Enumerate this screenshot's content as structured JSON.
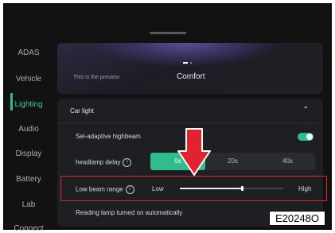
{
  "sidebar": {
    "items": [
      {
        "label": "ADAS"
      },
      {
        "label": "Vehicle"
      },
      {
        "label": "Lighting",
        "active": true
      },
      {
        "label": "Audio"
      },
      {
        "label": "Display"
      },
      {
        "label": "Battery"
      },
      {
        "label": "Lab"
      },
      {
        "label": "Connect"
      }
    ]
  },
  "preview": {
    "text": "This is the preview",
    "mode": "Comfort"
  },
  "car_light": {
    "title": "Car light",
    "adaptive_highbeam": {
      "label": "Sel-adaptive highbeam",
      "enabled": true
    },
    "headlamp_delay": {
      "label": "headlamp delay",
      "options": [
        "0s",
        "20s",
        "40s"
      ],
      "selected": "0s"
    },
    "low_beam_range": {
      "label": "Low beam range",
      "min_label": "Low",
      "max_label": "High",
      "level": 0.6
    },
    "reading_lamp": {
      "label": "Reading lamp turned on automatically"
    }
  },
  "annotation": {
    "figure_id": "E20248O",
    "arrow_color": "#e0242e",
    "highlight_color": "#e0242e"
  },
  "colors": {
    "accent": "#2fbd8e",
    "background": "#121213",
    "card": "#1e1f23"
  }
}
